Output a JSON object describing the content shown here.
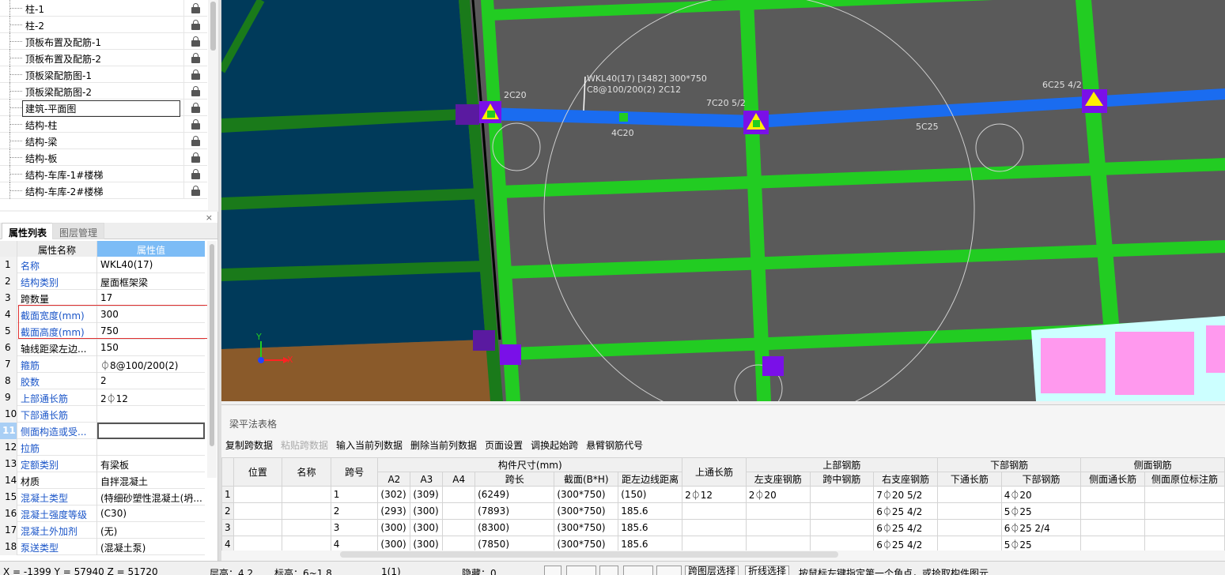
{
  "layer_tree": {
    "items": [
      {
        "label": "柱-1"
      },
      {
        "label": "柱-2"
      },
      {
        "label": "顶板布置及配筋-1"
      },
      {
        "label": "顶板布置及配筋-2"
      },
      {
        "label": "顶板梁配筋图-1"
      },
      {
        "label": "顶板梁配筋图-2"
      },
      {
        "label": "建筑-平面图",
        "selected": true
      },
      {
        "label": "结构-柱"
      },
      {
        "label": "结构-梁"
      },
      {
        "label": "结构-板"
      },
      {
        "label": "结构-车库-1#楼梯"
      },
      {
        "label": "结构-车库-2#楼梯"
      }
    ]
  },
  "props": {
    "close": "×",
    "tabs": [
      "属性列表",
      "图层管理"
    ],
    "header_name": "属性名称",
    "header_value": "属性值",
    "rows": [
      {
        "n": "1",
        "name": "名称",
        "value": "WKL40(17)",
        "blue": true
      },
      {
        "n": "2",
        "name": "结构类别",
        "value": "屋面框架梁",
        "blue": true
      },
      {
        "n": "3",
        "name": "跨数量",
        "value": "17",
        "blue": false
      },
      {
        "n": "4",
        "name": "截面宽度(mm)",
        "value": "300",
        "blue": true
      },
      {
        "n": "5",
        "name": "截面高度(mm)",
        "value": "750",
        "blue": true
      },
      {
        "n": "6",
        "name": "轴线距梁左边...",
        "value": "150",
        "blue": false
      },
      {
        "n": "7",
        "name": "箍筋",
        "value": "⏀8@100/200(2)",
        "blue": true
      },
      {
        "n": "8",
        "name": "胶数",
        "value": "2",
        "blue": true
      },
      {
        "n": "9",
        "name": "上部通长筋",
        "value": "2⏀12",
        "blue": true
      },
      {
        "n": "10",
        "name": "下部通长筋",
        "value": "",
        "blue": true
      },
      {
        "n": "11",
        "name": "侧面构造或受...",
        "value": "",
        "blue": true,
        "editing": true,
        "highlight": true
      },
      {
        "n": "12",
        "name": "拉筋",
        "value": "",
        "blue": true
      },
      {
        "n": "13",
        "name": "定额类别",
        "value": "有梁板",
        "blue": true
      },
      {
        "n": "14",
        "name": "材质",
        "value": "自拌混凝土",
        "blue": false
      },
      {
        "n": "15",
        "name": "混凝土类型",
        "value": "(特细砂塑性混凝土(坍...",
        "blue": true
      },
      {
        "n": "16",
        "name": "混凝土强度等级",
        "value": "(C30)",
        "blue": true
      },
      {
        "n": "17",
        "name": "混凝土外加剂",
        "value": "(无)",
        "blue": true
      },
      {
        "n": "18",
        "name": "泵送类型",
        "value": "(混凝土泵)",
        "blue": true
      }
    ]
  },
  "viewport": {
    "beam_label_1": "WKL40(17) [3482] 300*750",
    "beam_label_2": "C8@100/200(2) 2C12",
    "ann_2c20": "2C20",
    "ann_4c20": "4C20",
    "ann_7c20": "7C20 5/2",
    "ann_5c25": "5C25",
    "ann_6c25": "6C25 4/2",
    "axis_y": "Y",
    "axis_x": "X"
  },
  "beam_table": {
    "title": "梁平法表格",
    "toolbar": [
      {
        "label": "复制跨数据",
        "disabled": false
      },
      {
        "label": "粘贴跨数据",
        "disabled": true
      },
      {
        "label": "输入当前列数据",
        "disabled": false
      },
      {
        "label": "删除当前列数据",
        "disabled": false
      },
      {
        "label": "页面设置",
        "disabled": false
      },
      {
        "label": "调换起始跨",
        "disabled": false
      },
      {
        "label": "悬臂钢筋代号",
        "disabled": false
      }
    ],
    "headers": {
      "pos": "位置",
      "name": "名称",
      "span": "跨号",
      "dims": "构件尺寸(mm)",
      "top_through": "上通长筋",
      "top_bars": "上部钢筋",
      "bottom_bars": "下部钢筋",
      "side_bars": "侧面钢筋",
      "a2": "A2",
      "a3": "A3",
      "a4": "A4",
      "len": "跨长",
      "sect": "截面(B*H)",
      "off": "距左边线距离",
      "left_sup": "左支座钢筋",
      "mid": "跨中钢筋",
      "right_sup": "右支座钢筋",
      "bot_through": "下通长筋",
      "bot": "下部钢筋",
      "side_through": "侧面通长筋",
      "side_orig": "侧面原位标注筋"
    },
    "rows": [
      {
        "rn": "1",
        "pos": "",
        "name": "",
        "span": "1",
        "a2": "(302)",
        "a3": "(309)",
        "a4": "",
        "len": "(6249)",
        "sect": "(300*750)",
        "off": "(150)",
        "top_through": "2⏀12",
        "left_sup": "2⏀20",
        "mid": "",
        "right_sup": "7⏀20 5/2",
        "bot_through": "",
        "bot": "4⏀20",
        "side_through": "",
        "side_orig": ""
      },
      {
        "rn": "2",
        "pos": "",
        "name": "",
        "span": "2",
        "a2": "(293)",
        "a3": "(300)",
        "a4": "",
        "len": "(7893)",
        "sect": "(300*750)",
        "off": "185.6",
        "top_through": "",
        "left_sup": "",
        "mid": "",
        "right_sup": "6⏀25 4/2",
        "bot_through": "",
        "bot": "5⏀25",
        "side_through": "",
        "side_orig": ""
      },
      {
        "rn": "3",
        "pos": "",
        "name": "",
        "span": "3",
        "a2": "(300)",
        "a3": "(300)",
        "a4": "",
        "len": "(8300)",
        "sect": "(300*750)",
        "off": "185.6",
        "top_through": "",
        "left_sup": "",
        "mid": "",
        "right_sup": "6⏀25 4/2",
        "bot_through": "",
        "bot": "6⏀25 2/4",
        "side_through": "",
        "side_orig": ""
      },
      {
        "rn": "4",
        "pos": "",
        "name": "",
        "span": "4",
        "a2": "(300)",
        "a3": "(300)",
        "a4": "",
        "len": "(7850)",
        "sect": "(300*750)",
        "off": "185.6",
        "top_through": "",
        "left_sup": "",
        "mid": "",
        "right_sup": "6⏀25 4/2",
        "bot_through": "",
        "bot": "5⏀25",
        "side_through": "",
        "side_orig": ""
      }
    ]
  },
  "status": {
    "coords": "X = -1399 Y = 57940 Z = 51720",
    "floor_height": "层高：4.2",
    "elevation": "标高：6~1.8",
    "count": "1(1)",
    "hidden": "隐藏：0",
    "btn_cross_layer": "跨图层选择",
    "btn_polyline": "折线选择",
    "hint": "按鼠标左键指定第一个角点，或拾取构件图元"
  },
  "colors": {
    "viewport_bg": "#5a5a5a",
    "green": "#22cc22",
    "blue_beam": "#1a6cf0",
    "purple": "#7a10e8",
    "yellow": "#ffee00",
    "navy": "#003a5a",
    "brown": "#8a5a2a",
    "pink": "#ff99ee",
    "cyan": "#ccffff"
  }
}
